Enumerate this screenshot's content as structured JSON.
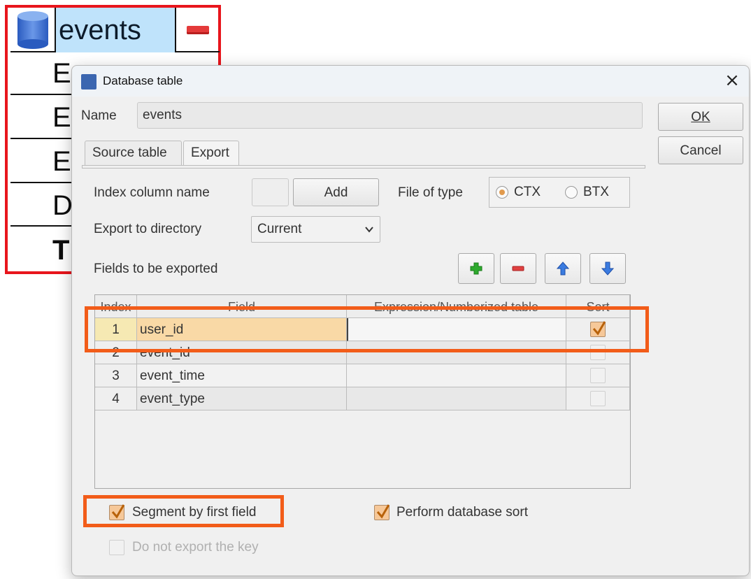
{
  "entity": {
    "title": "events",
    "rows": [
      "E",
      "E",
      "E",
      "D",
      "T"
    ]
  },
  "dialog": {
    "title": "Database table",
    "close_glyph": "×",
    "name_label": "Name",
    "name_value": "events",
    "ok_label": "OK",
    "cancel_label": "Cancel",
    "tabs": [
      {
        "label": "Source table",
        "active": false
      },
      {
        "label": "Export",
        "active": true
      }
    ],
    "export": {
      "index_column_label": "Index column name",
      "index_column_value": "",
      "add_label": "Add",
      "file_of_type_label": "File of type",
      "file_types": [
        {
          "label": "CTX",
          "selected": true
        },
        {
          "label": "BTX",
          "selected": false
        }
      ],
      "export_dir_label": "Export to directory",
      "export_dir_value": "Current",
      "fields_label": "Fields to be exported",
      "toolbar_icons": [
        "add-icon",
        "remove-icon",
        "move-up-icon",
        "move-down-icon"
      ],
      "columns": [
        "Index",
        "Field",
        "Expression/Numberized table",
        "Sort"
      ],
      "rows": [
        {
          "index": "1",
          "field": "user_id",
          "expression": "",
          "sort": true
        },
        {
          "index": "2",
          "field": "event_id",
          "expression": "",
          "sort": false
        },
        {
          "index": "3",
          "field": "event_time",
          "expression": "",
          "sort": false
        },
        {
          "index": "4",
          "field": "event_type",
          "expression": "",
          "sort": false
        }
      ],
      "segment_label": "Segment by first field",
      "segment_checked": true,
      "db_sort_label": "Perform database sort",
      "db_sort_checked": true,
      "no_key_label": "Do not export the key",
      "no_key_checked": false
    }
  },
  "colors": {
    "entity_border": "#e8151c",
    "highlight": "#f25c19",
    "selected_cell": "#f9d9a6",
    "index_selected": "#f6e9b3",
    "checkbox_checked": "#f6c899"
  }
}
